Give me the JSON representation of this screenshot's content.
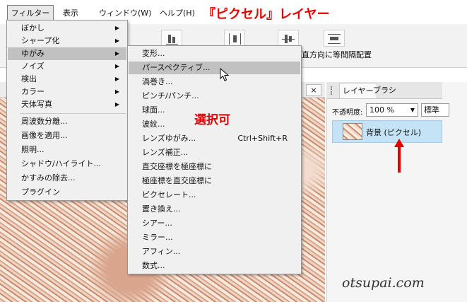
{
  "annotations": {
    "title": "『ピクセル』レイヤー",
    "selectable": "選択可",
    "color": "#e60000"
  },
  "menubar": {
    "items": [
      {
        "label": "フィルター"
      },
      {
        "label": "表示"
      },
      {
        "label": "ウィンドウ(W)"
      },
      {
        "label": "ヘルプ(H)"
      }
    ]
  },
  "toolbar": {
    "partial_label": "直方向に等間隔配置"
  },
  "canvas": {
    "close_glyph": "×"
  },
  "filter_menu": {
    "items": [
      {
        "label": "ぼかし",
        "submenu": true
      },
      {
        "label": "シャープ化",
        "submenu": true
      },
      {
        "label": "ゆがみ",
        "submenu": true,
        "highlighted": true
      },
      {
        "label": "ノイズ",
        "submenu": true
      },
      {
        "label": "検出",
        "submenu": true
      },
      {
        "label": "カラー",
        "submenu": true
      },
      {
        "label": "天体写真",
        "submenu": true
      },
      {
        "label": "周波数分離..."
      },
      {
        "label": "画像を適用..."
      },
      {
        "label": "照明..."
      },
      {
        "label": "シャドウ/ハイライト..."
      },
      {
        "label": "かすみの除去..."
      },
      {
        "label": "プラグイン"
      }
    ],
    "submenu_glyph": "▶"
  },
  "distort_menu": {
    "items": [
      {
        "label": "変形..."
      },
      {
        "label": "パースペクティブ...",
        "highlighted": true
      },
      {
        "label": "渦巻き..."
      },
      {
        "label": "ピンチ/パンチ..."
      },
      {
        "label": "球面..."
      },
      {
        "label": "波紋..."
      },
      {
        "label": "レンズゆがみ...",
        "shortcut": "Ctrl+Shift+R"
      },
      {
        "label": "レンズ補正..."
      },
      {
        "label": "直交座標を極座標に"
      },
      {
        "label": "極座標を直交座標に"
      },
      {
        "label": "ピクセレート..."
      },
      {
        "label": "置き換え..."
      },
      {
        "label": "シアー..."
      },
      {
        "label": "ミラー..."
      },
      {
        "label": "アフィン..."
      },
      {
        "label": "数式..."
      }
    ]
  },
  "layers_panel": {
    "tabs": [
      "レイヤー",
      "ブラシ"
    ],
    "opacity_label": "不透明度:",
    "opacity_value": "100 %",
    "opacity_arrow": "▼",
    "blend_mode": "標準",
    "layer": {
      "name": "背景 (ピクセル)",
      "selected": true
    }
  },
  "watermark": "otsupai.com"
}
